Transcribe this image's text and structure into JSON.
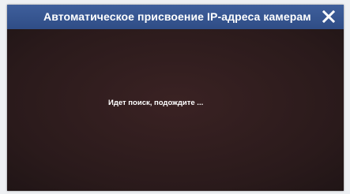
{
  "dialog": {
    "title": "Автоматическое присвоение IP-адреса камерам",
    "status_text": "Идет поиск, подождите ..."
  },
  "icons": {
    "close": "close-icon"
  },
  "colors": {
    "titlebar": "#3a5894",
    "background": "#2c1c1d",
    "text": "#ffffff"
  }
}
